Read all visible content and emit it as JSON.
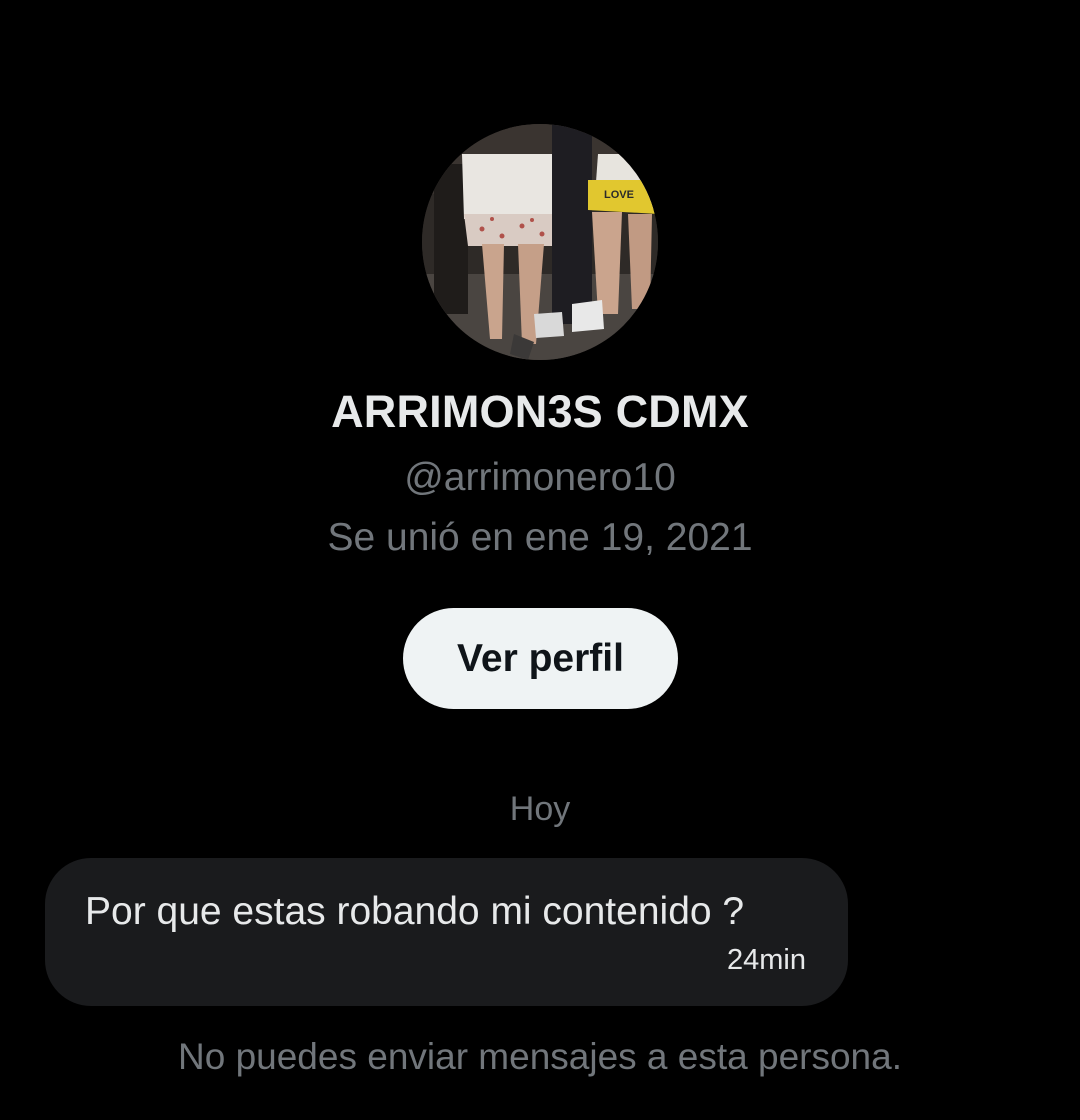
{
  "profile": {
    "display_name": "ARRIMON3S CDMX",
    "handle": "@arrimonero10",
    "joined": "Se unió en ene 19, 2021",
    "avatar_text": "LOVE",
    "view_profile_label": "Ver perfil"
  },
  "conversation": {
    "date_separator": "Hoy",
    "messages": [
      {
        "text": "Por que estas robando mi contenido ?",
        "time": "24min"
      }
    ],
    "notice": "No puedes enviar mensajes a esta persona."
  },
  "colors": {
    "background": "#000000",
    "primary_text": "#e7e9ea",
    "secondary_text": "#71767b",
    "button_bg": "#eff3f4",
    "button_text": "#0f1419",
    "bubble_bg": "#1a1b1d"
  }
}
